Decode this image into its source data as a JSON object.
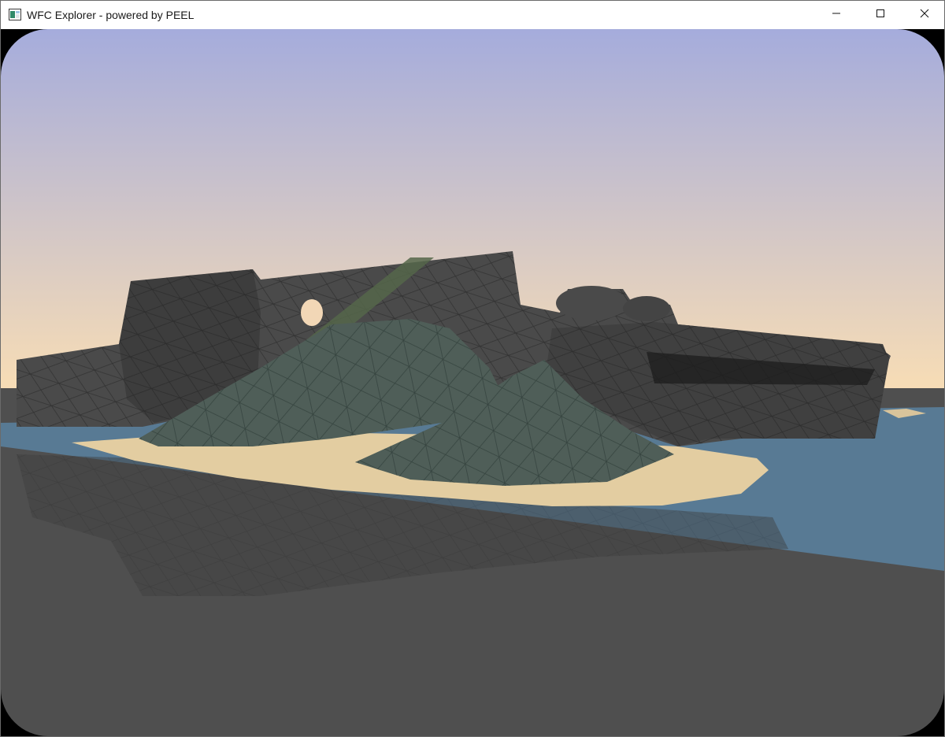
{
  "window": {
    "title": "WFC Explorer - powered by PEEL",
    "buttons": {
      "minimize": "minimize-icon",
      "maximize": "maximize-icon",
      "close": "close-icon"
    }
  },
  "scene": {
    "sky_top": "#a5acdc",
    "sky_bottom": "#f8ddb5",
    "ground_color": "#4f4f4f",
    "water_color": "#587a94",
    "sand_color": "#e3cda1",
    "rock_color": "#4a4a4a",
    "grass_color": "#4f5e58",
    "moss_color": "#55664a"
  }
}
